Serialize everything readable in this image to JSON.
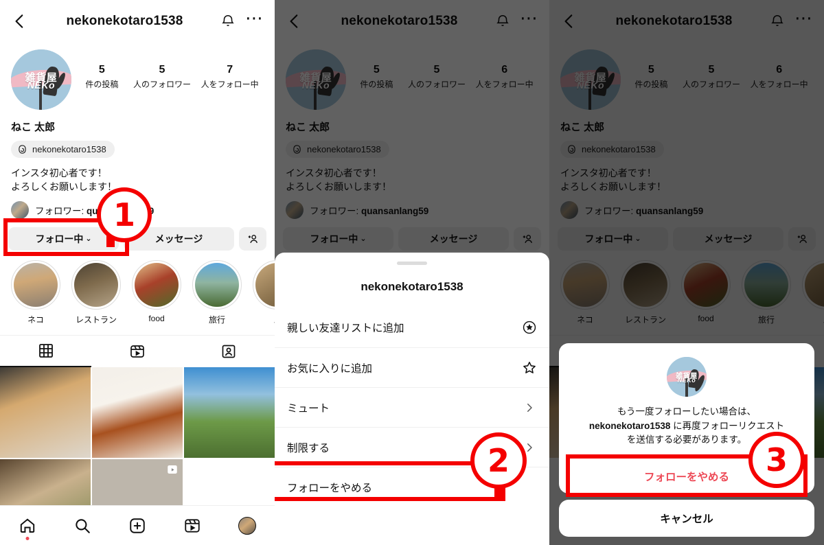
{
  "header": {
    "title": "nekonekotaro1538",
    "back_icon": "chevron-left-icon",
    "bell_icon": "bell-icon",
    "more_icon": "more-dots-icon"
  },
  "profile": {
    "avatar_logo_top": "雑貨屋",
    "avatar_logo_bottom": "NEKo",
    "display_name": "ねこ 太郎",
    "threads_handle": "nekonekotaro1538",
    "threads_icon": "threads-icon",
    "bio_line1": "インスタ初心者です！",
    "bio_line2": "よろしくお願いします！",
    "follower_prefix": "フォロワー: ",
    "follower_name": "quansanlang59"
  },
  "stats_panel1": [
    {
      "num": "5",
      "label": "件の投稿"
    },
    {
      "num": "5",
      "label": "人のフォロワー"
    },
    {
      "num": "7",
      "label": "人をフォロー中"
    }
  ],
  "stats_panel2": [
    {
      "num": "5",
      "label": "件の投稿"
    },
    {
      "num": "5",
      "label": "人のフォロワー"
    },
    {
      "num": "6",
      "label": "人をフォロー中"
    }
  ],
  "stats_panel3": [
    {
      "num": "5",
      "label": "件の投稿"
    },
    {
      "num": "5",
      "label": "人のフォロワー"
    },
    {
      "num": "6",
      "label": "人をフォロー中"
    }
  ],
  "actions": {
    "following": "フォロー中",
    "caret": "⌄",
    "message": "メッセージ",
    "add_person_icon": "add-person-icon"
  },
  "highlights": [
    {
      "name": "ネコ",
      "img": "img-cat1"
    },
    {
      "name": "レストラン",
      "img": "img-rest"
    },
    {
      "name": "food",
      "img": "img-food"
    },
    {
      "name": "旅行",
      "img": "img-trip"
    },
    {
      "name": "ス",
      "img": "img-fluffy"
    }
  ],
  "tabs": [
    {
      "icon": "grid-icon",
      "active": true
    },
    {
      "icon": "reels-icon",
      "active": false
    },
    {
      "icon": "tagged-icon",
      "active": false
    }
  ],
  "grid_cells": [
    {
      "style": "c-cat",
      "reel": false
    },
    {
      "style": "c-curry",
      "reel": false
    },
    {
      "style": "c-park",
      "reel": false
    },
    {
      "style": "c-dish",
      "reel": false
    },
    {
      "style": "c-grey",
      "reel": true
    },
    {
      "style": "c-blank",
      "reel": false
    }
  ],
  "bottom_nav": [
    {
      "icon": "home-icon",
      "dot": true
    },
    {
      "icon": "search-icon",
      "dot": false
    },
    {
      "icon": "create-icon",
      "dot": false
    },
    {
      "icon": "reels-icon",
      "dot": false
    },
    {
      "icon": "profile-avatar-icon",
      "dot": false
    }
  ],
  "sheet": {
    "title": "nekonekotaro1538",
    "rows": [
      {
        "label": "親しい友達リストに追加",
        "icon": "star-circle-icon"
      },
      {
        "label": "お気に入りに追加",
        "icon": "star-outline-icon"
      },
      {
        "label": "ミュート",
        "icon": "chevron-right-icon"
      },
      {
        "label": "制限する",
        "icon": "chevron-right-icon"
      },
      {
        "label": "フォローをやめる",
        "icon": "none"
      }
    ]
  },
  "alert": {
    "msg_line1": "もう一度フォローしたい場合は、",
    "msg_bold": "nekonekotaro1538",
    "msg_line2_tail": " に再度フォローリクエスト",
    "msg_line3": "を送信する必要があります。",
    "unfollow_label": "フォローをやめる",
    "cancel_label": "キャンセル",
    "unfollow_color": "#ed4956"
  },
  "annotations": {
    "step1": "1",
    "step2": "2",
    "step3": "3",
    "accent": "#f40000"
  }
}
